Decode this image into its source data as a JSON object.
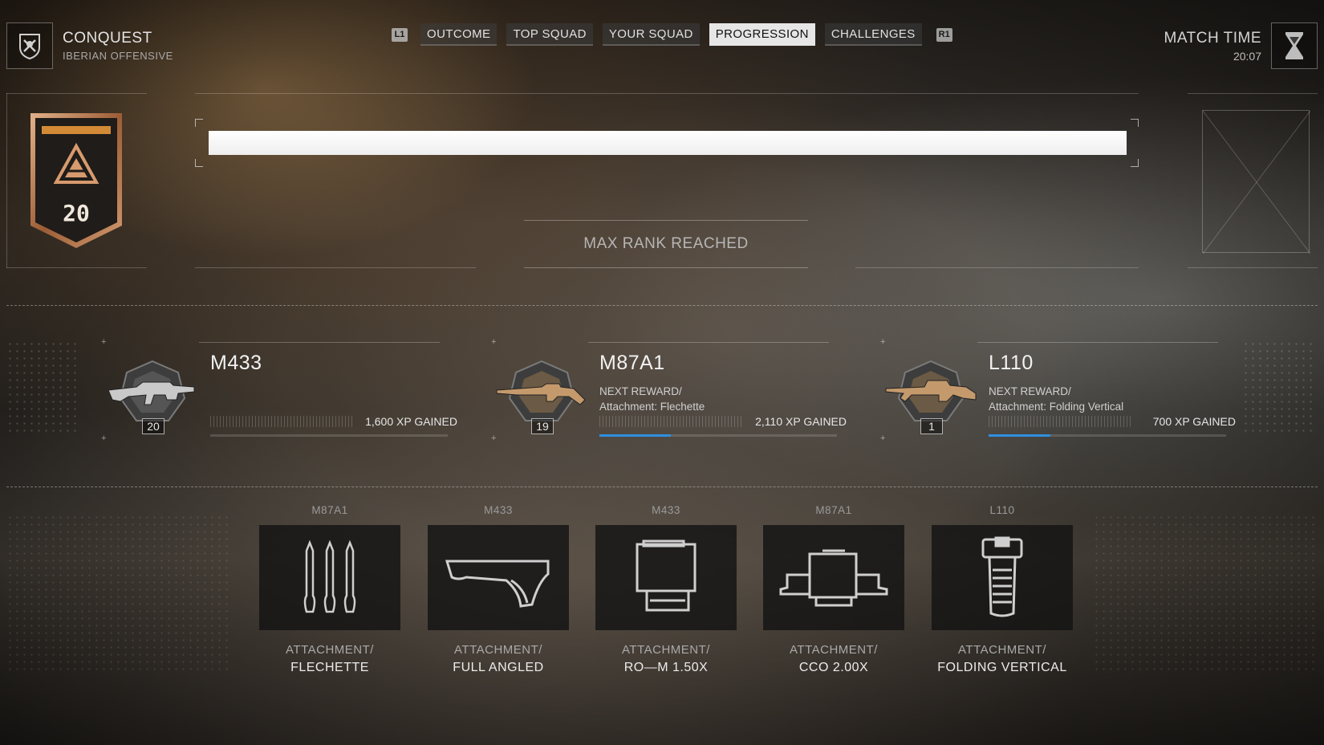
{
  "header": {
    "mode_title": "CONQUEST",
    "mode_subtitle": "IBERIAN OFFENSIVE",
    "mode_icon": "shield-crest-icon",
    "tabs": [
      {
        "label": "OUTCOME",
        "active": false
      },
      {
        "label": "TOP SQUAD",
        "active": false
      },
      {
        "label": "YOUR SQUAD",
        "active": false
      },
      {
        "label": "PROGRESSION",
        "active": true
      },
      {
        "label": "CHALLENGES",
        "active": false
      }
    ],
    "left_bumper": "L1",
    "right_bumper": "R1",
    "match_time_label": "MATCH TIME",
    "match_time_value": "20:07",
    "match_icon": "hourglass-icon"
  },
  "rank": {
    "level": "20",
    "progress": 1.0,
    "status": "MAX RANK REACHED"
  },
  "weapons": [
    {
      "name": "M433",
      "level": "20",
      "next_reward_label": "",
      "next_reward": "",
      "xp_text": "1,600 XP GAINED",
      "progress": 0.0
    },
    {
      "name": "M87A1",
      "level": "19",
      "next_reward_label": "NEXT REWARD/",
      "next_reward": "Attachment: Flechette",
      "xp_text": "2,110 XP GAINED",
      "progress": 0.3
    },
    {
      "name": "L110",
      "level": "1",
      "next_reward_label": "NEXT REWARD/",
      "next_reward": "Attachment: Folding Vertical",
      "xp_text": "700 XP GAINED",
      "progress": 0.26
    }
  ],
  "rewards": [
    {
      "weapon": "M87A1",
      "type": "ATTACHMENT/",
      "name": "FLECHETTE",
      "icon": "flechette-ammo-icon"
    },
    {
      "weapon": "M433",
      "type": "ATTACHMENT/",
      "name": "FULL ANGLED",
      "icon": "angled-grip-icon"
    },
    {
      "weapon": "M433",
      "type": "ATTACHMENT/",
      "name": "RO—M 1.50X",
      "icon": "reflex-sight-icon"
    },
    {
      "weapon": "M87A1",
      "type": "ATTACHMENT/",
      "name": "CCO 2.00X",
      "icon": "cco-sight-icon"
    },
    {
      "weapon": "L110",
      "type": "ATTACHMENT/",
      "name": "FOLDING VERTICAL",
      "icon": "vertical-grip-icon"
    }
  ],
  "colors": {
    "progress_blue": "#2f8fe0",
    "rank_bar": "#ffffff",
    "badge_bronze": "#b77a4c"
  }
}
